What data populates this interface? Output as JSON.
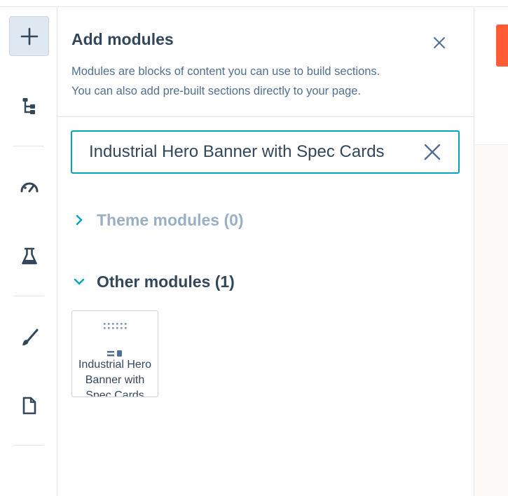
{
  "rail": {
    "items": [
      {
        "name": "add-icon"
      },
      {
        "name": "layers-tree-icon"
      },
      {
        "name": "gauge-icon"
      },
      {
        "name": "flask-icon"
      },
      {
        "name": "brush-icon"
      },
      {
        "name": "page-icon"
      }
    ]
  },
  "panel": {
    "title": "Add modules",
    "description_line1": "Modules are blocks of content you can use to build sections.",
    "description_line2": "You can also add pre-built sections directly to your page.",
    "search": {
      "value": "Industrial Hero Banner with Spec Cards",
      "placeholder": ""
    },
    "sections": [
      {
        "label": "Theme modules (0)",
        "expanded": false
      },
      {
        "label": "Other modules (1)",
        "expanded": true
      }
    ],
    "modules": [
      {
        "name": "Industrial Hero Banner with Spec Cards"
      }
    ]
  },
  "colors": {
    "accent": "#00a4bd",
    "text": "#33475b",
    "muted": "#99afc4",
    "brand": "#ff5c35"
  }
}
